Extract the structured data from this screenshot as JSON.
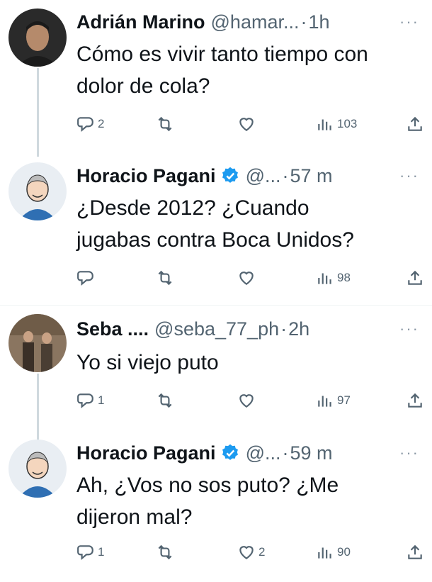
{
  "tweets": [
    {
      "name": "Adrián Marino",
      "handle": "@hamar...",
      "time": "1h",
      "verified": false,
      "text_lines": [
        "Cómo es vivir tanto tiempo con",
        "dolor de cola?"
      ],
      "replies": "2",
      "retweets": "",
      "likes": "",
      "views": "103"
    },
    {
      "name": "Horacio Pagani",
      "handle": "@...",
      "time": "57 m",
      "verified": true,
      "text_lines": [
        "¿Desde 2012? ¿Cuando",
        "jugabas contra Boca Unidos?"
      ],
      "replies": "",
      "retweets": "",
      "likes": "",
      "views": "98"
    },
    {
      "name": "Seba ....",
      "handle": "@seba_77_ph",
      "time": "2h",
      "verified": false,
      "text_lines": [
        "Yo si viejo puto"
      ],
      "replies": "1",
      "retweets": "",
      "likes": "",
      "views": "97"
    },
    {
      "name": "Horacio Pagani",
      "handle": "@...",
      "time": "59 m",
      "verified": true,
      "text_lines": [
        "Ah, ¿Vos no sos puto? ¿Me",
        "dijeron mal?"
      ],
      "replies": "1",
      "retweets": "",
      "likes": "2",
      "views": "90"
    }
  ],
  "separator": "·",
  "more_glyph": "···",
  "colors": {
    "text": "#0f1419",
    "muted": "#536471",
    "verified": "#1d9bf0",
    "thread_line": "#cfd9de"
  }
}
